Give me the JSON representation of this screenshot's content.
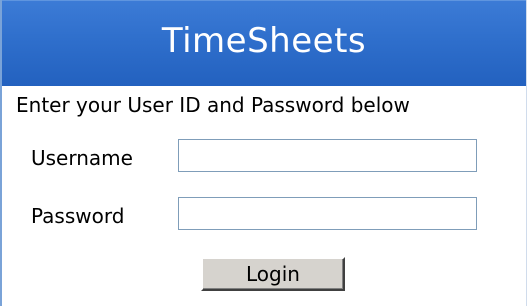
{
  "app": {
    "title": "TimeSheets",
    "header_color": "#2f6fcc"
  },
  "login_form": {
    "instruction": "Enter your User ID and Password below",
    "username": {
      "label": "Username",
      "value": ""
    },
    "password": {
      "label": "Password",
      "value": ""
    },
    "login_button_label": "Login"
  }
}
